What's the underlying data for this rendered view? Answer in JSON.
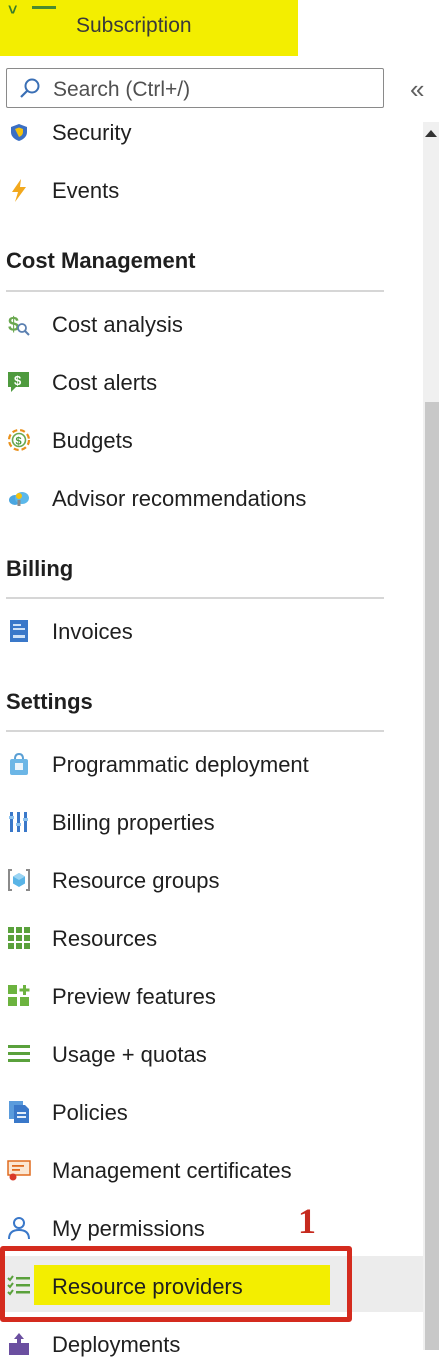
{
  "header": {
    "title": "Subscription"
  },
  "search": {
    "placeholder": "Search (Ctrl+/)"
  },
  "collapse_label": "«",
  "annotation": "1",
  "menu": {
    "security": "Security",
    "events": "Events",
    "cost_management": {
      "heading": "Cost Management",
      "cost_analysis": "Cost analysis",
      "cost_alerts": "Cost alerts",
      "budgets": "Budgets",
      "advisor_recommendations": "Advisor recommendations"
    },
    "billing": {
      "heading": "Billing",
      "invoices": "Invoices"
    },
    "settings": {
      "heading": "Settings",
      "programmatic_deployment": "Programmatic deployment",
      "billing_properties": "Billing properties",
      "resource_groups": "Resource groups",
      "resources": "Resources",
      "preview_features": "Preview features",
      "usage_quotas": "Usage + quotas",
      "policies": "Policies",
      "management_certificates": "Management certificates",
      "my_permissions": "My permissions",
      "resource_providers": "Resource providers",
      "deployments": "Deployments"
    }
  },
  "selected_item": "Resource providers",
  "colors": {
    "highlight": "#f3ee00",
    "annotation_red": "#d42b1e",
    "selected_bg": "#ececec"
  }
}
